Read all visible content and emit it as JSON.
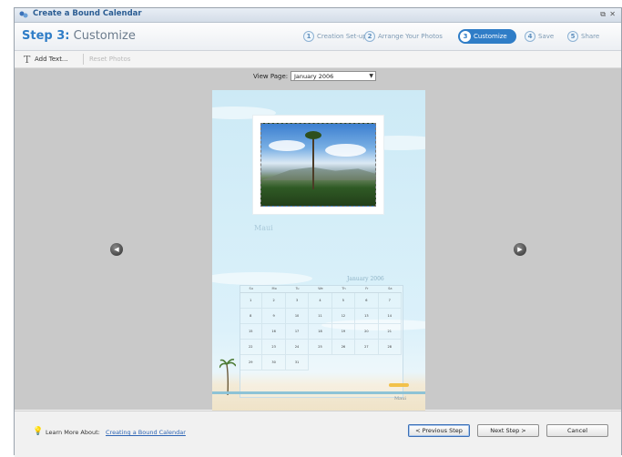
{
  "window": {
    "title": "Create a Bound Calendar",
    "restore_glyph": "⧉",
    "close_glyph": "✕"
  },
  "step": {
    "number": "Step 3:",
    "name": "Customize"
  },
  "progress": [
    {
      "num": "1",
      "label": "Creation Set-up",
      "active": false
    },
    {
      "num": "2",
      "label": "Arrange Your Photos",
      "active": false
    },
    {
      "num": "3",
      "label": "Customize",
      "active": true
    },
    {
      "num": "4",
      "label": "Save",
      "active": false
    },
    {
      "num": "5",
      "label": "Share",
      "active": false
    }
  ],
  "toolbar": {
    "add_text": "Add Text...",
    "reset_photos": "Reset Photos"
  },
  "view_page": {
    "label": "View Page:",
    "value": "January 2006"
  },
  "calendar_page": {
    "caption": "Maui",
    "month": "January   2006",
    "weekdays": [
      "Su",
      "Mo",
      "Tu",
      "We",
      "Th",
      "Fr",
      "Sa"
    ],
    "days": [
      "1",
      "2",
      "3",
      "4",
      "5",
      "6",
      "7",
      "8",
      "9",
      "10",
      "11",
      "12",
      "13",
      "14",
      "15",
      "16",
      "17",
      "18",
      "19",
      "20",
      "21",
      "22",
      "23",
      "24",
      "25",
      "26",
      "27",
      "28",
      "29",
      "30",
      "31"
    ],
    "sign": "Maui"
  },
  "footer": {
    "learn_label": "Learn More About:",
    "learn_link": "Creating a Bound Calendar",
    "prev": "< Previous Step",
    "next": "Next Step >",
    "cancel": "Cancel"
  },
  "colors": {
    "accent": "#2f7dc7",
    "title": "#2b5d93",
    "link": "#2c64b4"
  }
}
